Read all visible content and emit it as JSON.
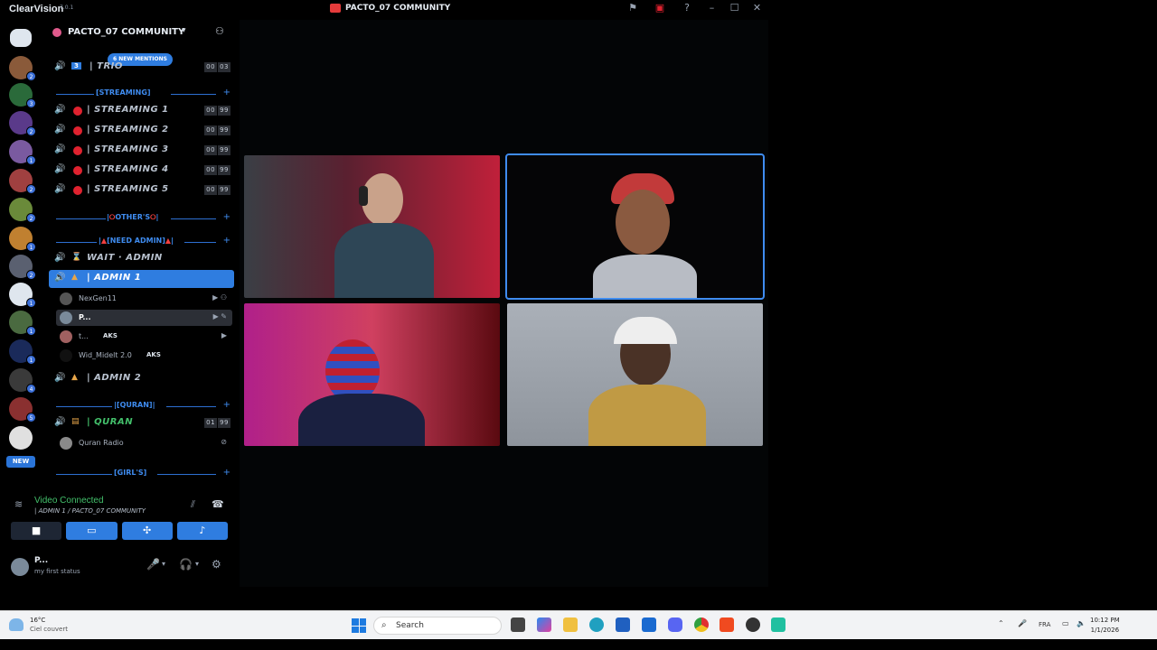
{
  "app": {
    "name": "ClearVision",
    "version": "7.0.1",
    "window_title": "PACTO_07 COMMUNITY"
  },
  "server": {
    "name": "PACTO_07 COMMUNITY",
    "mentions": "6 NEW MENTIONS"
  },
  "rail": {
    "new_label": "NEW",
    "badges": [
      "2",
      "3",
      "2",
      "1",
      "2",
      "2",
      "1",
      "2",
      "1",
      "1",
      "1",
      "4",
      "5"
    ]
  },
  "channels": {
    "trio": {
      "label": "TRIO",
      "num": "3",
      "count_a": "00",
      "count_b": "03"
    },
    "cat_streaming": "[STREAMING]",
    "streaming": [
      {
        "label": "| STREAMING 1",
        "count_a": "00",
        "count_b": "99"
      },
      {
        "label": "| STREAMING 2",
        "count_a": "00",
        "count_b": "99"
      },
      {
        "label": "| STREAMING 3",
        "count_a": "00",
        "count_b": "99"
      },
      {
        "label": "| STREAMING 4",
        "count_a": "00",
        "count_b": "99"
      },
      {
        "label": "| STREAMING 5",
        "count_a": "00",
        "count_b": "99"
      }
    ],
    "cat_others": "OTHER'S",
    "cat_need_admin": "NEED ADMIN",
    "wait_admin": "WAIT · ADMIN",
    "admin1": "| ADMIN 1",
    "admin1_users": [
      {
        "name": "NexGen11",
        "tag": ""
      },
      {
        "name": "P...",
        "tag": ""
      },
      {
        "name": "t...",
        "tag": "AKS"
      },
      {
        "name": "Wid_Midelt 2.0",
        "tag": "AKS"
      }
    ],
    "admin2": "| ADMIN 2",
    "cat_quran": "QURAN",
    "quran": {
      "label": "| QURAN",
      "count_a": "01",
      "count_b": "99"
    },
    "quran_user": "Quran Radio",
    "cat_girls": "GIRL'S"
  },
  "voice": {
    "status": "Video Connected",
    "channel": "| ADMIN 1 / PACTO_07 COMMUNITY"
  },
  "user": {
    "name": "P...",
    "status": "my first status"
  },
  "taskbar": {
    "temp": "16°C",
    "weather": "Ciel couvert",
    "search_placeholder": "Search",
    "lang": "FRA",
    "time": "10:12 PM",
    "date": "1/1/2026"
  },
  "colors": {
    "accent": "#2f7de0",
    "connected": "#43c06b",
    "live": "#e0222f"
  }
}
